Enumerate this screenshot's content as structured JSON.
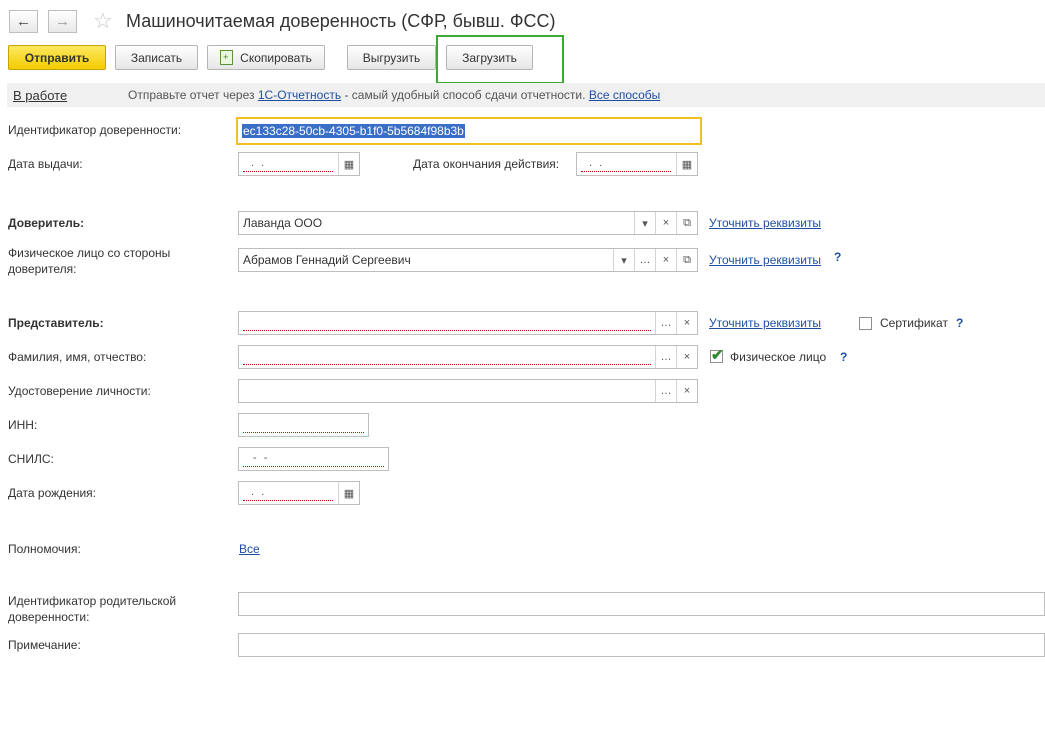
{
  "window": {
    "title": "Машиночитаемая доверенность (СФР, бывш. ФСС)",
    "back_icon": "arrow-left-icon",
    "forward_icon": "arrow-right-icon",
    "favorite_icon": "star-icon"
  },
  "toolbar": {
    "send": "Отправить",
    "save": "Записать",
    "copy": "Скопировать",
    "export": "Выгрузить",
    "import": "Загрузить"
  },
  "status": {
    "state": "В работе",
    "message_prefix": "Отправьте отчет через",
    "service_link": "1С-Отчетность",
    "message_suffix": "- самый удобный способ сдачи отчетности.",
    "all_methods_link": "Все способы"
  },
  "form": {
    "id_label": "Идентификатор доверенности:",
    "id_value": "ec133c28-50cb-4305-b1f0-5b5684f98b3b",
    "issue_date_label": "Дата выдачи:",
    "issue_date_mask": ".  .",
    "end_date_label": "Дата окончания действия:",
    "end_date_mask": ".  .",
    "principal_label": "Доверитель:",
    "principal_value": "Лаванда ООО",
    "principal_link": "Уточнить реквизиты",
    "principal_person_label": "Физическое лицо со стороны доверителя:",
    "principal_person_value": "Абрамов Геннадий Сергеевич",
    "principal_person_link": "Уточнить реквизиты",
    "representative_label": "Представитель:",
    "representative_link": "Уточнить реквизиты",
    "certificate_label": "Сертификат",
    "certificate_checked": false,
    "fio_label": "Фамилия, имя, отчество:",
    "individual_label": "Физическое лицо",
    "individual_checked": true,
    "identity_doc_label": "Удостоверение личности:",
    "inn_label": "ИНН:",
    "snils_label": "СНИЛС:",
    "snils_mask": "-   -",
    "birth_date_label": "Дата рождения:",
    "birth_date_mask": ".  .",
    "powers_label": "Полномочия:",
    "powers_link": "Все",
    "parent_id_label": "Идентификатор родительской доверенности:",
    "note_label": "Примечание:",
    "help_mark": "?"
  },
  "colors": {
    "primary_button": "#f3cc00",
    "highlight_border": "#3aaa35",
    "link": "#1f4fa3",
    "focus_border": "#f0c020",
    "selection": "#3a6fc7"
  }
}
